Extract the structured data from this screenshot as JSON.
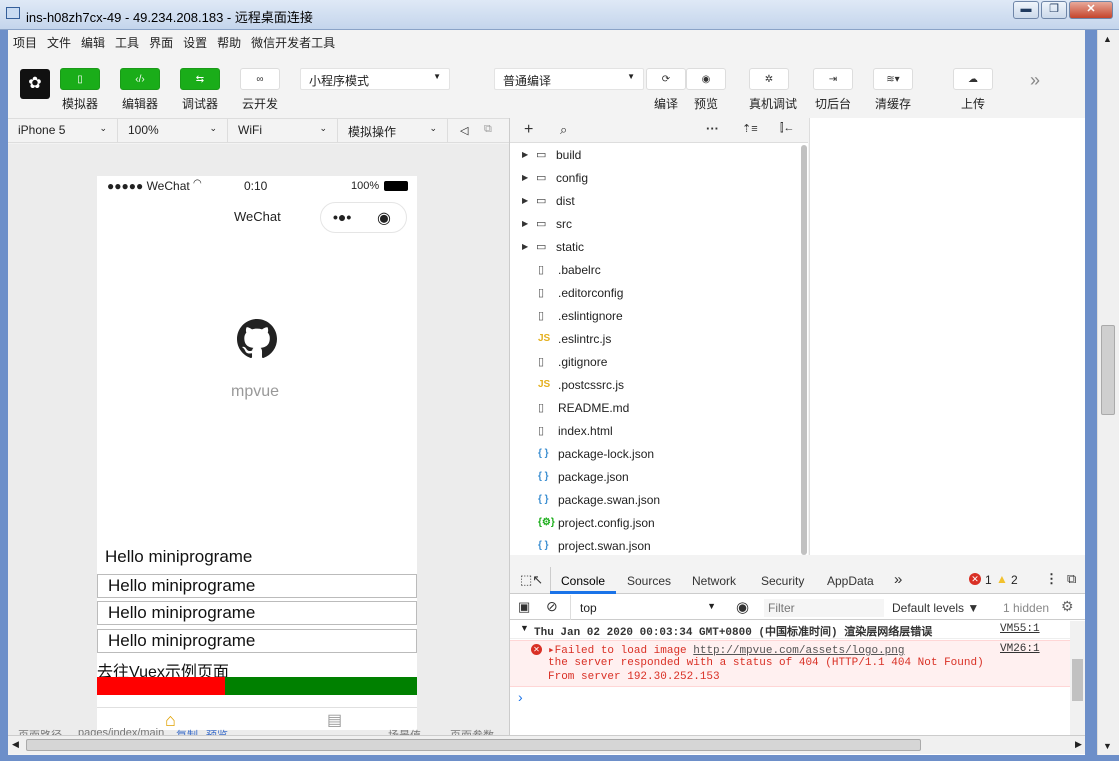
{
  "window": {
    "title": "ins-h08zh7cx-49 - 49.234.208.183 - 远程桌面连接",
    "minimize": "▬",
    "maximize": "❐",
    "close": "✕"
  },
  "menu": [
    "项目",
    "文件",
    "编辑",
    "工具",
    "界面",
    "设置",
    "帮助",
    "微信开发者工具"
  ],
  "toolbar": {
    "simulator": "模拟器",
    "editor": "编辑器",
    "debugger": "调试器",
    "cloud": "云开发",
    "mode": "小程序模式",
    "compile_mode": "普通编译",
    "compile": "编译",
    "preview": "预览",
    "remote_debug": "真机调试",
    "background": "切后台",
    "clear_cache": "清缓存",
    "upload": "上传",
    "more": "»"
  },
  "device_bar": {
    "device": "iPhone 5",
    "zoom": "100%",
    "network": "WiFi",
    "operation": "模拟操作"
  },
  "phone": {
    "status_carrier": "●●●●● WeChat",
    "status_time": "0:10",
    "status_battery": "100%",
    "nav_title": "WeChat",
    "logo_text": "mpvue",
    "hello_plain": "Hello miniprograme",
    "hello_items": [
      "Hello miniprograme",
      "Hello miniprograme",
      "Hello miniprograme"
    ],
    "vuex_link": "去往Vuex示例页面"
  },
  "path_bar": {
    "path_label": "页面路径",
    "path": "pages/index/main",
    "copy": "复制",
    "preview": "预览",
    "scene": "场景值",
    "params": "页面参数"
  },
  "explorer": {
    "items": [
      {
        "name": "build",
        "type": "folder"
      },
      {
        "name": "config",
        "type": "folder"
      },
      {
        "name": "dist",
        "type": "folder"
      },
      {
        "name": "src",
        "type": "folder"
      },
      {
        "name": "static",
        "type": "folder"
      },
      {
        "name": ".babelrc",
        "type": "file"
      },
      {
        "name": ".editorconfig",
        "type": "file"
      },
      {
        "name": ".eslintignore",
        "type": "file"
      },
      {
        "name": ".eslintrc.js",
        "type": "js"
      },
      {
        "name": ".gitignore",
        "type": "file"
      },
      {
        "name": ".postcssrc.js",
        "type": "js"
      },
      {
        "name": "README.md",
        "type": "file"
      },
      {
        "name": "index.html",
        "type": "file"
      },
      {
        "name": "package-lock.json",
        "type": "json"
      },
      {
        "name": "package.json",
        "type": "json"
      },
      {
        "name": "package.swan.json",
        "type": "json"
      },
      {
        "name": "project.config.json",
        "type": "config"
      },
      {
        "name": "project.swan.json",
        "type": "json"
      }
    ]
  },
  "console": {
    "tabs": [
      "Console",
      "Sources",
      "Network",
      "Security",
      "AppData"
    ],
    "more": "»",
    "error_count": "1",
    "warning_count": "2",
    "context": "top",
    "filter_placeholder": "Filter",
    "levels": "Default levels ▼",
    "hidden": "1 hidden",
    "group_header": "Thu Jan 02 2020 00:03:34 GMT+0800 (中国标准时间) 渲染层网络层错误",
    "group_source": "VM55:1",
    "error_line1_prefix": "Failed to load image ",
    "error_url": "http://mpvue.com/assets/logo.png",
    "error_line2": "the server responded with a status of 404 (HTTP/1.1 404 Not Found)",
    "error_line3": "From server 192.30.252.153",
    "error_source": "VM26:1",
    "prompt": "›"
  },
  "colors": {
    "accent_green": "#1aad19",
    "error_red": "#d93025",
    "warning_yellow": "#f2c12e",
    "bar_red": "#ff0000",
    "bar_green": "#008000",
    "js_yellow": "#e4b01f",
    "json_blue": "#3d8fd1"
  }
}
